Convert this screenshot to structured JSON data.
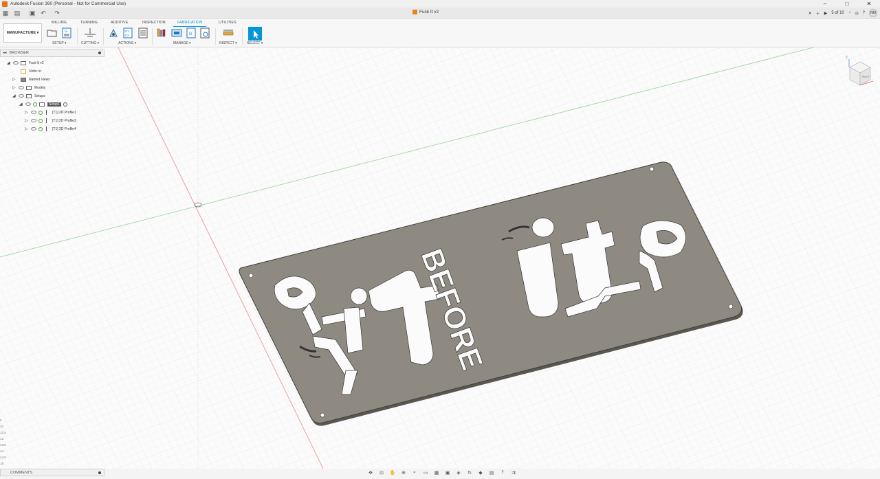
{
  "window": {
    "title": "Autodesk Fusion 360 (Personal - Not for Commercial Use)",
    "controls": [
      "–",
      "□",
      "✕"
    ]
  },
  "document": {
    "tab_name": "Fuck It v2",
    "job_status": "5 of 10",
    "user_initials": "NM"
  },
  "workspace": {
    "label": "MANUFACTURE ▾"
  },
  "menu_tabs": [
    {
      "label": "MILLING"
    },
    {
      "label": "TURNING"
    },
    {
      "label": "ADDITIVE"
    },
    {
      "label": "INSPECTION"
    },
    {
      "label": "FABRICATION",
      "active": true
    },
    {
      "label": "UTILITIES"
    }
  ],
  "tool_groups": {
    "setup": "SETUP ▾",
    "cutting": "CUTTING ▾",
    "actions": "ACTIONS ▾",
    "manage": "MANAGE ▾",
    "inspect": "INSPECT ▾",
    "select": "SELECT ▾"
  },
  "browser": {
    "title": "BROWSER",
    "rows": {
      "root": "Fuck It v2",
      "units": "Units: in",
      "named_views": "Named Views",
      "models": "Models",
      "setups": "Setups",
      "setup1": "Setup1",
      "op1": "[T1] 2D Profile1",
      "op2": "[T1] 2D Profile3",
      "op3": "[T1] 2D Profile4"
    }
  },
  "comments": {
    "title": "COMMENTS"
  },
  "viewcube": {
    "face_label": "RIGHT",
    "axis_label": "Z"
  },
  "ruler_ticks": [
    "5",
    "10",
    "12.5",
    "13",
    "13.5",
    "14",
    "14.5",
    "15"
  ],
  "part_text": {
    "word1": "BEFORE",
    "word_it_left": "it",
    "word_it_right": "it"
  },
  "colors": {
    "accent": "#0696d7",
    "part": "#8e8a82",
    "grid": "#e2e2e2",
    "axis_green": "#a4d8a4",
    "axis_red": "#e8a0a0"
  }
}
